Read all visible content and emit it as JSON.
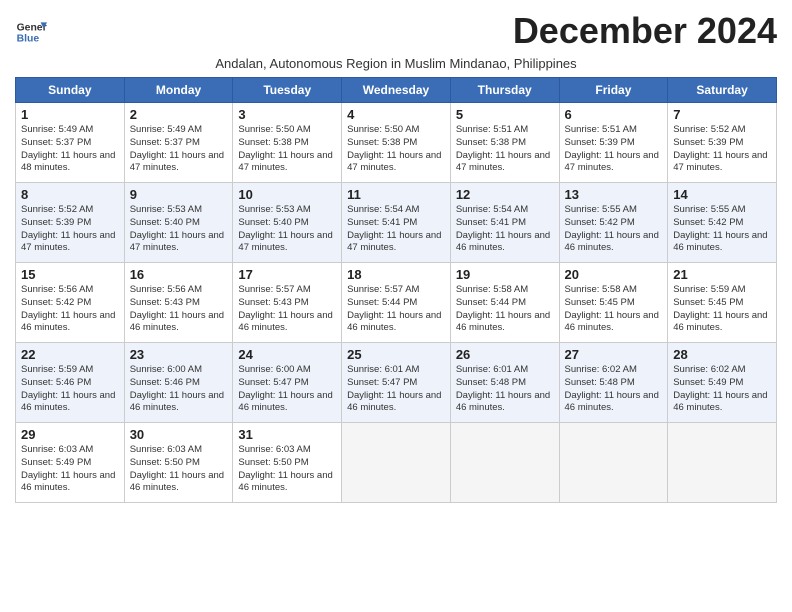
{
  "logo": {
    "line1": "General",
    "line2": "Blue"
  },
  "title": "December 2024",
  "subtitle": "Andalan, Autonomous Region in Muslim Mindanao, Philippines",
  "days_of_week": [
    "Sunday",
    "Monday",
    "Tuesday",
    "Wednesday",
    "Thursday",
    "Friday",
    "Saturday"
  ],
  "weeks": [
    [
      {
        "day": 1,
        "sunrise": "5:49 AM",
        "sunset": "5:37 PM",
        "daylight": "11 hours and 48 minutes."
      },
      {
        "day": 2,
        "sunrise": "5:49 AM",
        "sunset": "5:37 PM",
        "daylight": "11 hours and 47 minutes."
      },
      {
        "day": 3,
        "sunrise": "5:50 AM",
        "sunset": "5:38 PM",
        "daylight": "11 hours and 47 minutes."
      },
      {
        "day": 4,
        "sunrise": "5:50 AM",
        "sunset": "5:38 PM",
        "daylight": "11 hours and 47 minutes."
      },
      {
        "day": 5,
        "sunrise": "5:51 AM",
        "sunset": "5:38 PM",
        "daylight": "11 hours and 47 minutes."
      },
      {
        "day": 6,
        "sunrise": "5:51 AM",
        "sunset": "5:39 PM",
        "daylight": "11 hours and 47 minutes."
      },
      {
        "day": 7,
        "sunrise": "5:52 AM",
        "sunset": "5:39 PM",
        "daylight": "11 hours and 47 minutes."
      }
    ],
    [
      {
        "day": 8,
        "sunrise": "5:52 AM",
        "sunset": "5:39 PM",
        "daylight": "11 hours and 47 minutes."
      },
      {
        "day": 9,
        "sunrise": "5:53 AM",
        "sunset": "5:40 PM",
        "daylight": "11 hours and 47 minutes."
      },
      {
        "day": 10,
        "sunrise": "5:53 AM",
        "sunset": "5:40 PM",
        "daylight": "11 hours and 47 minutes."
      },
      {
        "day": 11,
        "sunrise": "5:54 AM",
        "sunset": "5:41 PM",
        "daylight": "11 hours and 47 minutes."
      },
      {
        "day": 12,
        "sunrise": "5:54 AM",
        "sunset": "5:41 PM",
        "daylight": "11 hours and 46 minutes."
      },
      {
        "day": 13,
        "sunrise": "5:55 AM",
        "sunset": "5:42 PM",
        "daylight": "11 hours and 46 minutes."
      },
      {
        "day": 14,
        "sunrise": "5:55 AM",
        "sunset": "5:42 PM",
        "daylight": "11 hours and 46 minutes."
      }
    ],
    [
      {
        "day": 15,
        "sunrise": "5:56 AM",
        "sunset": "5:42 PM",
        "daylight": "11 hours and 46 minutes."
      },
      {
        "day": 16,
        "sunrise": "5:56 AM",
        "sunset": "5:43 PM",
        "daylight": "11 hours and 46 minutes."
      },
      {
        "day": 17,
        "sunrise": "5:57 AM",
        "sunset": "5:43 PM",
        "daylight": "11 hours and 46 minutes."
      },
      {
        "day": 18,
        "sunrise": "5:57 AM",
        "sunset": "5:44 PM",
        "daylight": "11 hours and 46 minutes."
      },
      {
        "day": 19,
        "sunrise": "5:58 AM",
        "sunset": "5:44 PM",
        "daylight": "11 hours and 46 minutes."
      },
      {
        "day": 20,
        "sunrise": "5:58 AM",
        "sunset": "5:45 PM",
        "daylight": "11 hours and 46 minutes."
      },
      {
        "day": 21,
        "sunrise": "5:59 AM",
        "sunset": "5:45 PM",
        "daylight": "11 hours and 46 minutes."
      }
    ],
    [
      {
        "day": 22,
        "sunrise": "5:59 AM",
        "sunset": "5:46 PM",
        "daylight": "11 hours and 46 minutes."
      },
      {
        "day": 23,
        "sunrise": "6:00 AM",
        "sunset": "5:46 PM",
        "daylight": "11 hours and 46 minutes."
      },
      {
        "day": 24,
        "sunrise": "6:00 AM",
        "sunset": "5:47 PM",
        "daylight": "11 hours and 46 minutes."
      },
      {
        "day": 25,
        "sunrise": "6:01 AM",
        "sunset": "5:47 PM",
        "daylight": "11 hours and 46 minutes."
      },
      {
        "day": 26,
        "sunrise": "6:01 AM",
        "sunset": "5:48 PM",
        "daylight": "11 hours and 46 minutes."
      },
      {
        "day": 27,
        "sunrise": "6:02 AM",
        "sunset": "5:48 PM",
        "daylight": "11 hours and 46 minutes."
      },
      {
        "day": 28,
        "sunrise": "6:02 AM",
        "sunset": "5:49 PM",
        "daylight": "11 hours and 46 minutes."
      }
    ],
    [
      {
        "day": 29,
        "sunrise": "6:03 AM",
        "sunset": "5:49 PM",
        "daylight": "11 hours and 46 minutes."
      },
      {
        "day": 30,
        "sunrise": "6:03 AM",
        "sunset": "5:50 PM",
        "daylight": "11 hours and 46 minutes."
      },
      {
        "day": 31,
        "sunrise": "6:03 AM",
        "sunset": "5:50 PM",
        "daylight": "11 hours and 46 minutes."
      },
      null,
      null,
      null,
      null
    ]
  ]
}
